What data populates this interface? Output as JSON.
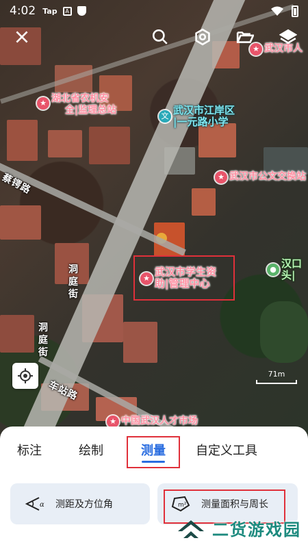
{
  "status_bar": {
    "time": "4:02",
    "app_label": "Tap",
    "notif_icon": "A"
  },
  "map": {
    "pois": [
      {
        "name": "武汉市人",
        "kind": "gov"
      },
      {
        "name": "湖北省农机安全监理总站",
        "line1": "湖北省农机安",
        "line2": "全|监理总站",
        "kind": "gov"
      },
      {
        "name": "武汉市江岸区一元路小学",
        "line1": "武汉市江岸区",
        "line2": "|一元路小学",
        "kind": "school",
        "pin": "文"
      },
      {
        "name": "武汉市公文交换站",
        "kind": "gov"
      },
      {
        "name": "武汉市学生资助管理中心",
        "line1": "武汉市学生资",
        "line2": "助|管理中心",
        "kind": "gov"
      },
      {
        "name": "汉口头",
        "line1": "汉口",
        "line2": "头|",
        "kind": "park"
      },
      {
        "name": "中国武汉人才市场",
        "kind": "gov"
      }
    ],
    "streets": [
      {
        "name": "蔡锷路"
      },
      {
        "name": "洞庭街",
        "line1": "洞",
        "line2": "庭",
        "line3": "街"
      },
      {
        "name": "洞庭街2",
        "line1": "洞",
        "line2": "庭",
        "line3": "街"
      },
      {
        "name": "车站路"
      }
    ],
    "scale_label": "71m"
  },
  "tabs": [
    {
      "label": "标注",
      "active": false
    },
    {
      "label": "绘制",
      "active": false
    },
    {
      "label": "测量",
      "active": true
    },
    {
      "label": "自定义工具",
      "active": false
    }
  ],
  "tools": [
    {
      "label": "测距及方位角",
      "icon": "angle-icon"
    },
    {
      "label": "测量面积与周长",
      "icon": "area-icon"
    }
  ],
  "watermark": {
    "text": "二货游戏园"
  },
  "colors": {
    "accent": "#2a6de0",
    "highlight": "#e0303a",
    "card_bg": "#e8eef6"
  }
}
